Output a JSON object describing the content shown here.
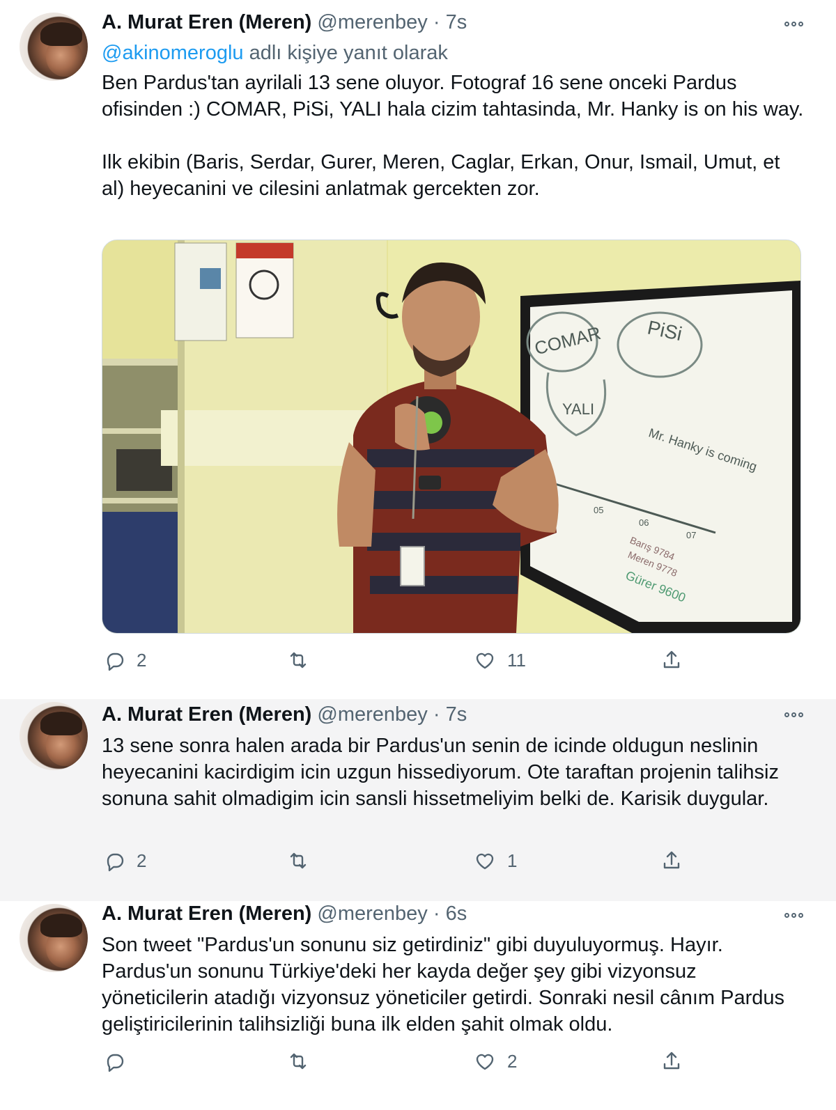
{
  "tweets": [
    {
      "author": "A. Murat Eren (Meren)",
      "handle": "@merenbey",
      "time": "7s",
      "reply_mention": "@akinomeroglu",
      "reply_suffix": "adlı kişiye yanıt olarak",
      "text": "Ben Pardus'tan ayrilali 13 sene oluyor. Fotograf 16 sene onceki Pardus ofisinden :) COMAR, PiSi, YALI hala cizim tahtasinda, Mr. Hanky is on his way.\n\nIlk ekibin (Baris, Serdar, Gurer, Meren, Caglar, Erkan, Onur, Ismail, Umut, et al) heyecanini ve cilesini anlatmak gercekten zor.",
      "whiteboard": {
        "bubble1": "COMAR",
        "bubble2": "PiSi",
        "bubble3": "YALI",
        "arrow": "Mr. Hanky is coming",
        "t1": "05",
        "t2": "06",
        "t3": "07",
        "note1": "Barış 9784",
        "note2": "Meren 9778",
        "note3": "Gürer 9600"
      },
      "replies": "2",
      "retweets": "",
      "likes": "11"
    },
    {
      "author": "A. Murat Eren (Meren)",
      "handle": "@merenbey",
      "time": "7s",
      "text": "13 sene sonra halen arada bir Pardus'un senin de icinde oldugun neslinin heyecanini kacirdigim icin uzgun hissediyorum. Ote taraftan projenin talihsiz sonuna sahit olmadigim icin sansli hissetmeliyim belki de. Karisik duygular.",
      "replies": "2",
      "retweets": "",
      "likes": "1"
    },
    {
      "author": "A. Murat Eren (Meren)",
      "handle": "@merenbey",
      "time": "6s",
      "text": "Son tweet \"Pardus'un sonunu siz getirdiniz\" gibi duyuluyormuş. Hayır. Pardus'un sonunu Türkiye'deki her kayda değer şey gibi vizyonsuz yöneticilerin atadığı vizyonsuz yöneticiler getirdi. Sonraki nesil cânım Pardus geliştiricilerinin talihsizliği buna ilk elden şahit olmak oldu.",
      "replies": "",
      "retweets": "",
      "likes": "2"
    }
  ],
  "separator": "·",
  "icons": {
    "reply": "reply-icon",
    "retweet": "retweet-icon",
    "like": "heart-icon",
    "share": "share-icon",
    "more": "more-options-icon"
  },
  "colors": {
    "link": "#1d9bf0",
    "secondary_text": "#536471",
    "thread_line": "#c4cfd6",
    "highlight_background": "#f4f4f5"
  }
}
